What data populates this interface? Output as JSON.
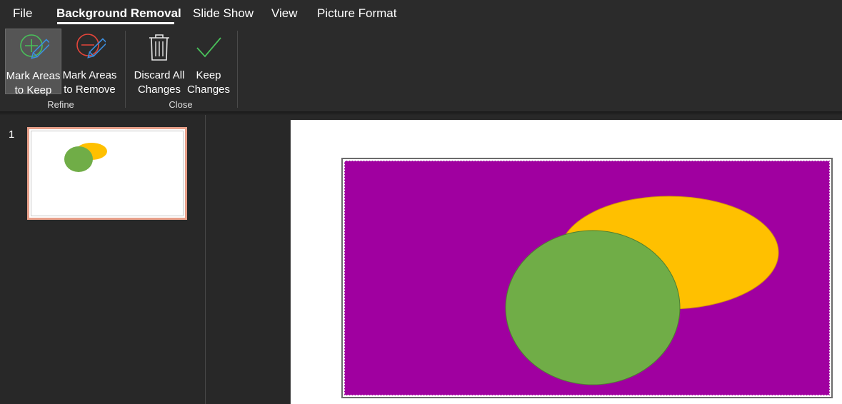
{
  "menu": {
    "tabs": [
      {
        "label": "File"
      },
      {
        "label": "Background Removal"
      },
      {
        "label": "Slide Show"
      },
      {
        "label": "View"
      },
      {
        "label": "Picture Format"
      }
    ]
  },
  "ribbon": {
    "refine": {
      "group_label": "Refine",
      "mark_keep_line1": "Mark Areas",
      "mark_keep_line2": "to Keep",
      "mark_remove_line1": "Mark Areas",
      "mark_remove_line2": "to Remove"
    },
    "close": {
      "group_label": "Close",
      "discard_line1": "Discard All",
      "discard_line2": "Changes",
      "keep_line1": "Keep",
      "keep_line2": "Changes"
    }
  },
  "thumbnails": [
    {
      "number": "1"
    }
  ],
  "colors": {
    "background_removal_area": "#a000a0",
    "yellow_ellipse": "#ffc000",
    "green_ellipse": "#70ad47",
    "keep_icon": "#49c05a",
    "remove_icon": "#e5453a",
    "pencil": "#3c8ede",
    "thumb_border": "#e8a08a"
  },
  "icons": {
    "mark_keep": "plus-circle-pencil-icon",
    "mark_remove": "minus-circle-pencil-icon",
    "discard": "trash-icon",
    "keep": "checkmark-icon"
  }
}
